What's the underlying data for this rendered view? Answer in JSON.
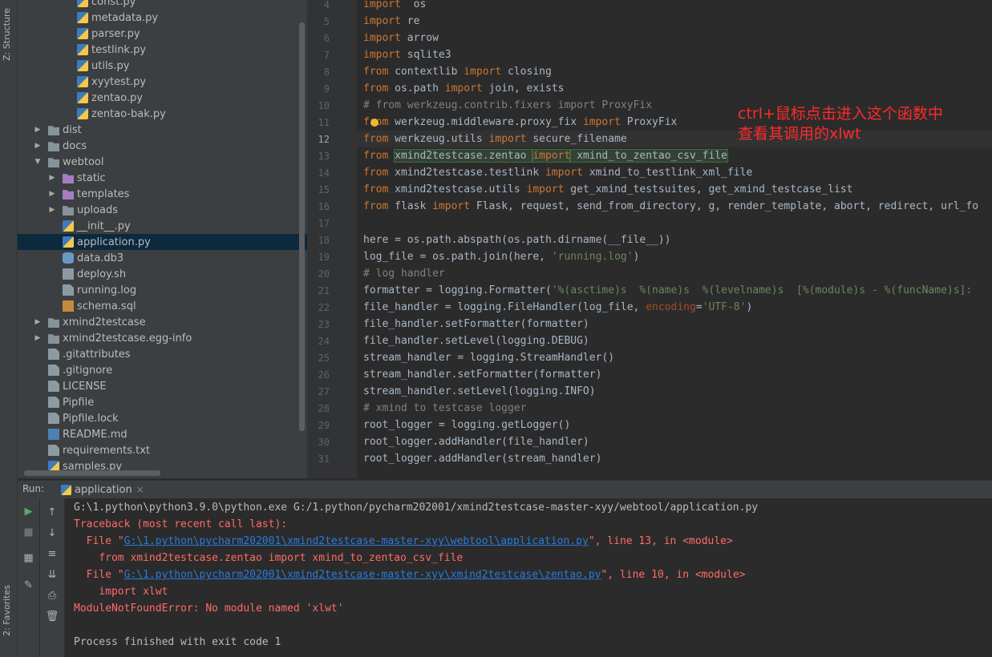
{
  "side_labels": {
    "structure": "Z: Structure",
    "favorites": "2: Favorites"
  },
  "project_tree": [
    {
      "label": "const.py",
      "icon": "python-file-icon",
      "depth": 3
    },
    {
      "label": "metadata.py",
      "icon": "python-file-icon",
      "depth": 3
    },
    {
      "label": "parser.py",
      "icon": "python-file-icon",
      "depth": 3
    },
    {
      "label": "testlink.py",
      "icon": "python-file-icon",
      "depth": 3
    },
    {
      "label": "utils.py",
      "icon": "python-file-icon",
      "depth": 3
    },
    {
      "label": "xyytest.py",
      "icon": "python-file-icon",
      "depth": 3
    },
    {
      "label": "zentao.py",
      "icon": "python-file-icon",
      "depth": 3
    },
    {
      "label": "zentao-bak.py",
      "icon": "python-file-icon",
      "depth": 3
    },
    {
      "label": "dist",
      "icon": "folder-icon",
      "depth": 1,
      "arrow": "▶"
    },
    {
      "label": "docs",
      "icon": "folder-icon",
      "depth": 1,
      "arrow": "▶"
    },
    {
      "label": "webtool",
      "icon": "module-folder-icon",
      "depth": 1,
      "arrow": "▼"
    },
    {
      "label": "static",
      "icon": "resource-folder-icon",
      "depth": 2,
      "arrow": "▶"
    },
    {
      "label": "templates",
      "icon": "resource-folder-icon",
      "depth": 2,
      "arrow": "▶"
    },
    {
      "label": "uploads",
      "icon": "folder-icon",
      "depth": 2,
      "arrow": "▶"
    },
    {
      "label": "__init__.py",
      "icon": "python-file-icon",
      "depth": 2
    },
    {
      "label": "application.py",
      "icon": "python-file-icon",
      "depth": 2,
      "selected": true
    },
    {
      "label": "data.db3",
      "icon": "database-icon",
      "depth": 2
    },
    {
      "label": "deploy.sh",
      "icon": "shell-file-icon",
      "depth": 2
    },
    {
      "label": "running.log",
      "icon": "text-file-icon",
      "depth": 2
    },
    {
      "label": "schema.sql",
      "icon": "sql-file-icon",
      "depth": 2
    },
    {
      "label": "xmind2testcase",
      "icon": "module-folder-icon",
      "depth": 1,
      "arrow": "▶"
    },
    {
      "label": "xmind2testcase.egg-info",
      "icon": "folder-icon",
      "depth": 1,
      "arrow": "▶"
    },
    {
      "label": ".gitattributes",
      "icon": "text-file-icon",
      "depth": 1
    },
    {
      "label": ".gitignore",
      "icon": "text-file-icon",
      "depth": 1
    },
    {
      "label": "LICENSE",
      "icon": "text-file-icon",
      "depth": 1
    },
    {
      "label": "Pipfile",
      "icon": "text-file-icon",
      "depth": 1
    },
    {
      "label": "Pipfile.lock",
      "icon": "text-file-icon",
      "depth": 1
    },
    {
      "label": "README.md",
      "icon": "markdown-file-icon",
      "depth": 1
    },
    {
      "label": "requirements.txt",
      "icon": "text-file-icon",
      "depth": 1
    },
    {
      "label": "samples.py",
      "icon": "python-file-icon",
      "depth": 1
    }
  ],
  "editor": {
    "current_line": 12,
    "lines": [
      {
        "n": "4",
        "t": [
          [
            "kw",
            "import"
          ],
          [
            "",
            "  os"
          ]
        ]
      },
      {
        "n": "5",
        "t": [
          [
            "kw",
            "import"
          ],
          [
            "",
            " re"
          ]
        ]
      },
      {
        "n": "6",
        "t": [
          [
            "kw",
            "import"
          ],
          [
            "",
            " arrow"
          ]
        ]
      },
      {
        "n": "7",
        "t": [
          [
            "kw",
            "import"
          ],
          [
            "",
            " sqlite3"
          ]
        ]
      },
      {
        "n": "8",
        "t": [
          [
            "kw",
            "from"
          ],
          [
            "",
            " contextlib "
          ],
          [
            "kw",
            "import"
          ],
          [
            "",
            " closing"
          ]
        ]
      },
      {
        "n": "9",
        "t": [
          [
            "kw",
            "from"
          ],
          [
            "",
            " os.path "
          ],
          [
            "kw",
            "import"
          ],
          [
            "",
            " join, exists"
          ]
        ]
      },
      {
        "n": "10",
        "t": [
          [
            "cmt",
            "# from werkzeug.contrib.fixers import ProxyFix"
          ]
        ]
      },
      {
        "n": "11",
        "t": [
          [
            "kw",
            "from"
          ],
          [
            "",
            " werkzeug.middleware.proxy_fix "
          ],
          [
            "kw",
            "import"
          ],
          [
            "",
            " ProxyFix"
          ]
        ]
      },
      {
        "n": "12",
        "t": [
          [
            "kw",
            "from"
          ],
          [
            "",
            " werkzeug.utils "
          ],
          [
            "kw",
            "import"
          ],
          [
            "",
            " secure_filename"
          ]
        ]
      },
      {
        "n": "13",
        "t": [
          [
            "kw",
            "from"
          ],
          [
            "",
            " "
          ],
          [
            "hl",
            "xmind2testcase.zentao "
          ],
          [
            "hlkw",
            "import"
          ],
          [
            "hl",
            " xmind_to_zentao_csv_file"
          ]
        ]
      },
      {
        "n": "14",
        "t": [
          [
            "kw",
            "from"
          ],
          [
            "",
            " xmind2testcase.testlink "
          ],
          [
            "kw",
            "import"
          ],
          [
            "",
            " xmind_to_testlink_xml_file"
          ]
        ]
      },
      {
        "n": "15",
        "t": [
          [
            "kw",
            "from"
          ],
          [
            "",
            " xmind2testcase.utils "
          ],
          [
            "kw",
            "import"
          ],
          [
            "",
            " get_xmind_testsuites, get_xmind_testcase_list"
          ]
        ]
      },
      {
        "n": "16",
        "t": [
          [
            "kw",
            "from"
          ],
          [
            "",
            " flask "
          ],
          [
            "kw",
            "import"
          ],
          [
            "",
            " Flask, request, send_from_directory, g, render_template, abort, redirect, url_fo"
          ]
        ]
      },
      {
        "n": "17",
        "t": []
      },
      {
        "n": "18",
        "t": [
          [
            "",
            "here = os.path.abspath(os.path.dirname(__file__))"
          ]
        ]
      },
      {
        "n": "19",
        "t": [
          [
            "",
            "log_file = os.path.join(here, "
          ],
          [
            "str",
            "'running.log'"
          ],
          [
            "",
            ")"
          ]
        ]
      },
      {
        "n": "20",
        "t": [
          [
            "cmt",
            "# log handler"
          ]
        ]
      },
      {
        "n": "21",
        "t": [
          [
            "",
            "formatter = logging.Formatter("
          ],
          [
            "str",
            "'%(asctime)s  %(name)s  %(levelname)s  [%(module)s - %(funcName)s]:"
          ]
        ]
      },
      {
        "n": "22",
        "t": [
          [
            "",
            "file_handler = logging.FileHandler(log_file, "
          ],
          [
            "param",
            "encoding"
          ],
          [
            "",
            "="
          ],
          [
            "str",
            "'UTF-8'"
          ],
          [
            "",
            ")"
          ]
        ]
      },
      {
        "n": "23",
        "t": [
          [
            "",
            "file_handler.setFormatter(formatter)"
          ]
        ]
      },
      {
        "n": "24",
        "t": [
          [
            "",
            "file_handler.setLevel(logging.DEBUG)"
          ]
        ]
      },
      {
        "n": "25",
        "t": [
          [
            "",
            "stream_handler = logging.StreamHandler()"
          ]
        ]
      },
      {
        "n": "26",
        "t": [
          [
            "",
            "stream_handler.setFormatter(formatter)"
          ]
        ]
      },
      {
        "n": "27",
        "t": [
          [
            "",
            "stream_handler.setLevel(logging.INFO)"
          ]
        ]
      },
      {
        "n": "28",
        "t": [
          [
            "cmt",
            "# xmind to testcase logger"
          ]
        ]
      },
      {
        "n": "29",
        "t": [
          [
            "",
            "root_logger = logging.getLogger()"
          ]
        ]
      },
      {
        "n": "30",
        "t": [
          [
            "",
            "root_logger.addHandler(file_handler)"
          ]
        ]
      },
      {
        "n": "31",
        "t": [
          [
            "",
            "root_logger.addHandler(stream_handler)"
          ]
        ]
      }
    ]
  },
  "annotation": {
    "line1": "ctrl+鼠标点击进入这个函数中",
    "line2": "查看其调用的xlwt"
  },
  "run_panel": {
    "label": "Run:",
    "tab": "application",
    "tab_close": "×"
  },
  "console": [
    [
      [
        "normal",
        "G:\\1.python\\python3.9.0\\python.exe G:/1.python/pycharm202001/xmind2testcase-master-xyy/webtool/application.py"
      ]
    ],
    [
      [
        "err",
        "Traceback (most recent call last):"
      ]
    ],
    [
      [
        "err",
        "  File \""
      ],
      [
        "link",
        "G:\\1.python\\pycharm202001\\xmind2testcase-master-xyy\\webtool\\application.py"
      ],
      [
        "err",
        "\", line 13, in <module>"
      ]
    ],
    [
      [
        "err",
        "    from xmind2testcase.zentao import xmind_to_zentao_csv_file"
      ]
    ],
    [
      [
        "err",
        "  File \""
      ],
      [
        "link",
        "G:\\1.python\\pycharm202001\\xmind2testcase-master-xyy\\xmind2testcase\\zentao.py"
      ],
      [
        "err",
        "\", line 10, in <module>"
      ]
    ],
    [
      [
        "err",
        "    import xlwt"
      ]
    ],
    [
      [
        "err",
        "ModuleNotFoundError: No module named 'xlwt'"
      ]
    ],
    [
      [
        "normal",
        ""
      ]
    ],
    [
      [
        "normal",
        "Process finished with exit code 1"
      ]
    ]
  ]
}
